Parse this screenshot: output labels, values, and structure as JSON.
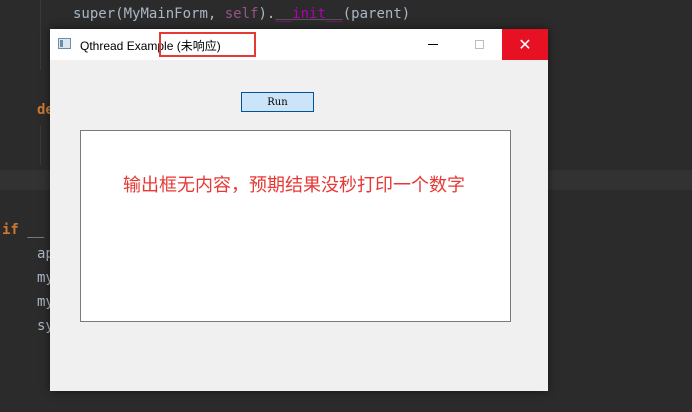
{
  "editor": {
    "line_super": [
      "super",
      "(MyMainForm, ",
      "self",
      ").",
      "__init__",
      "(parent)"
    ],
    "line_def": "de",
    "line_if": [
      "if",
      " __"
    ],
    "line_ap": "ap",
    "line_my1": "my",
    "line_my2": "my",
    "line_sy": "sy"
  },
  "window": {
    "title": "Qthread Example (未响应)",
    "minimize_label": "",
    "maximize_label": "",
    "close_label": "✕"
  },
  "form": {
    "run_label": "Run",
    "output_text": ""
  },
  "annotation": {
    "text": "输出框无内容，预期结果没秒打印一个数字",
    "color": "#e53935"
  },
  "colors": {
    "editor_bg": "#2b2b2b",
    "close_button": "#e81123",
    "highlight_border": "#e53935",
    "run_button_bg": "#cce4f7"
  }
}
